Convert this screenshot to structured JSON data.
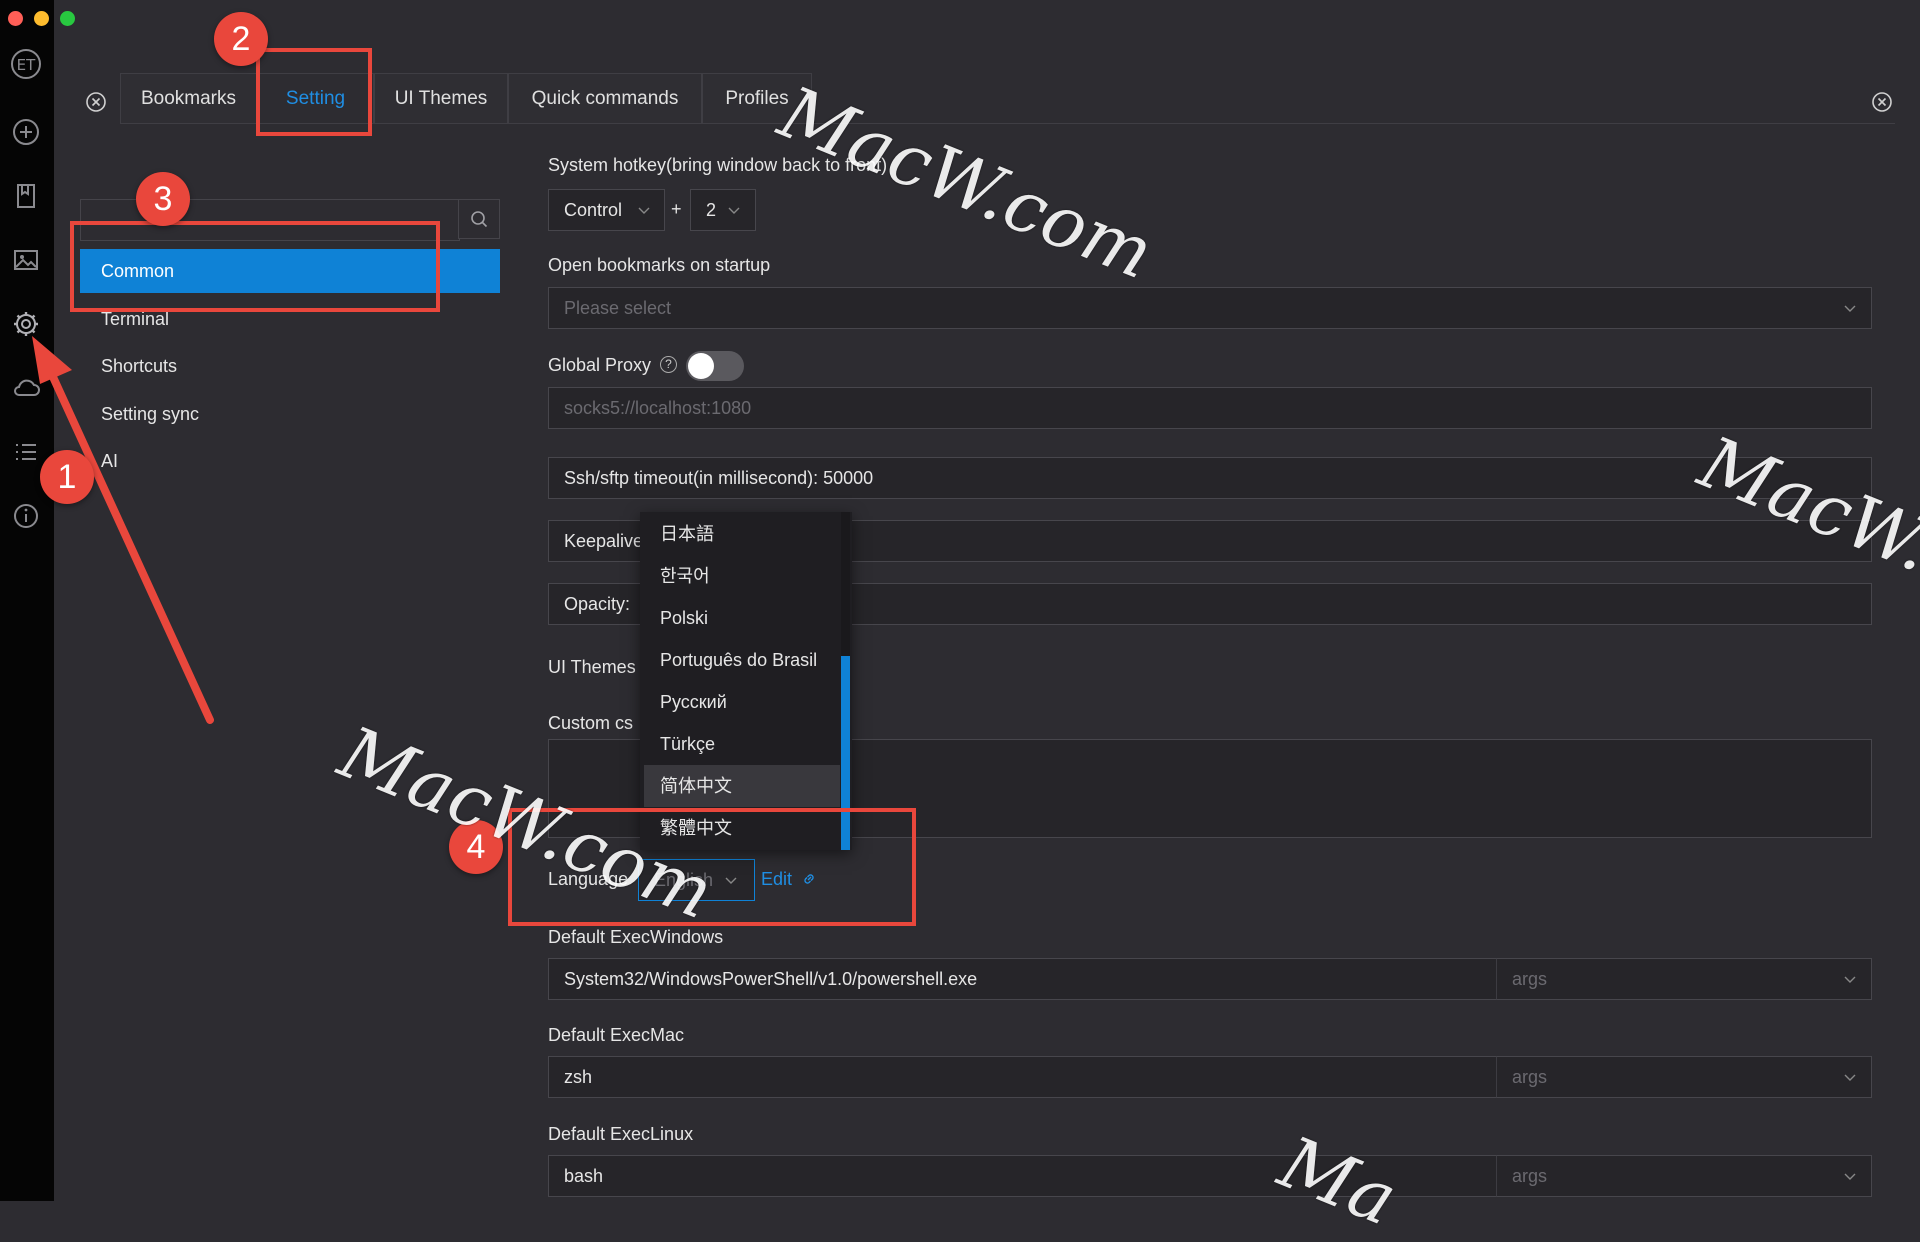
{
  "window": {
    "traffic_colors": [
      "#ff5f57",
      "#febc2e",
      "#28c840"
    ]
  },
  "app_sidebar": {
    "icons": [
      "logo-icon",
      "add-icon",
      "bookmark-icon",
      "image-icon",
      "gear-icon",
      "cloud-icon",
      "list-icon",
      "info-icon"
    ]
  },
  "tabs": [
    {
      "label": "Bookmarks"
    },
    {
      "label": "Setting"
    },
    {
      "label": "UI Themes"
    },
    {
      "label": "Quick commands"
    },
    {
      "label": "Profiles"
    }
  ],
  "settings_nav": {
    "search_placeholder": "",
    "items": [
      {
        "label": "Common"
      },
      {
        "label": "Terminal"
      },
      {
        "label": "Shortcuts"
      },
      {
        "label": "Setting sync"
      },
      {
        "label": "AI"
      }
    ]
  },
  "form": {
    "hotkey_label": "System hotkey(bring window back to front)",
    "hotkey_modifier": "Control",
    "hotkey_plus": "+",
    "hotkey_key": "2",
    "open_bookmarks_label": "Open bookmarks on startup",
    "open_bookmarks_placeholder": "Please select",
    "global_proxy_label": "Global Proxy",
    "global_proxy_help": "?",
    "proxy_placeholder": "socks5://localhost:1080",
    "timeout_field": "Ssh/sftp timeout(in millisecond): 50000",
    "keepalive_field": "Keepalive",
    "opacity_field": "Opacity:",
    "ui_themes_label": "UI Themes",
    "custom_css_label": "Custom cs",
    "language_label": "Language",
    "language_value": "English",
    "language_edit": "Edit",
    "exec_windows_label": "Default ExecWindows",
    "exec_windows_value": "System32/WindowsPowerShell/v1.0/powershell.exe",
    "exec_mac_label": "Default ExecMac",
    "exec_mac_value": "zsh",
    "exec_linux_label": "Default ExecLinux",
    "exec_linux_value": "bash",
    "args_placeholder": "args"
  },
  "language_options": [
    "日本語",
    "한국어",
    "Polski",
    "Português do Brasil",
    "Русский",
    "Türkçe",
    "简体中文",
    "繁體中文"
  ],
  "annotations": {
    "badges": [
      "1",
      "2",
      "3",
      "4"
    ],
    "color": "#e9473c"
  },
  "watermarks": [
    "MacW.com",
    "MacW.c",
    "MacW.com",
    "Ma"
  ],
  "colors": {
    "accent": "#0f82d6",
    "background": "#2d2c31"
  }
}
